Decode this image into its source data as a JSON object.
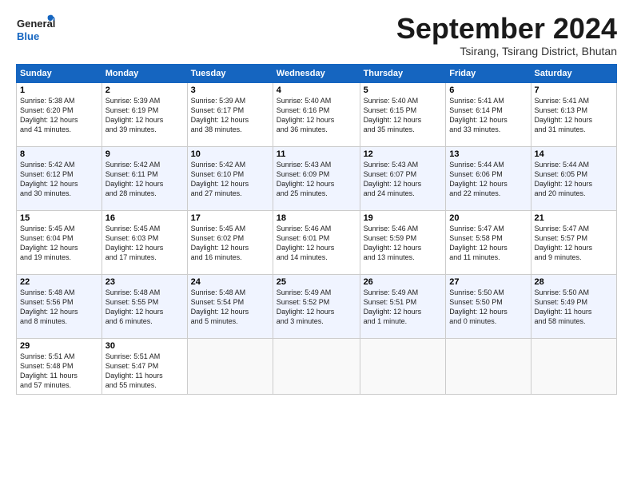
{
  "header": {
    "logo_general": "General",
    "logo_blue": "Blue",
    "month": "September 2024",
    "location": "Tsirang, Tsirang District, Bhutan"
  },
  "days_of_week": [
    "Sunday",
    "Monday",
    "Tuesday",
    "Wednesday",
    "Thursday",
    "Friday",
    "Saturday"
  ],
  "weeks": [
    [
      {
        "day": "1",
        "lines": [
          "Sunrise: 5:38 AM",
          "Sunset: 6:20 PM",
          "Daylight: 12 hours",
          "and 41 minutes."
        ]
      },
      {
        "day": "2",
        "lines": [
          "Sunrise: 5:39 AM",
          "Sunset: 6:19 PM",
          "Daylight: 12 hours",
          "and 39 minutes."
        ]
      },
      {
        "day": "3",
        "lines": [
          "Sunrise: 5:39 AM",
          "Sunset: 6:17 PM",
          "Daylight: 12 hours",
          "and 38 minutes."
        ]
      },
      {
        "day": "4",
        "lines": [
          "Sunrise: 5:40 AM",
          "Sunset: 6:16 PM",
          "Daylight: 12 hours",
          "and 36 minutes."
        ]
      },
      {
        "day": "5",
        "lines": [
          "Sunrise: 5:40 AM",
          "Sunset: 6:15 PM",
          "Daylight: 12 hours",
          "and 35 minutes."
        ]
      },
      {
        "day": "6",
        "lines": [
          "Sunrise: 5:41 AM",
          "Sunset: 6:14 PM",
          "Daylight: 12 hours",
          "and 33 minutes."
        ]
      },
      {
        "day": "7",
        "lines": [
          "Sunrise: 5:41 AM",
          "Sunset: 6:13 PM",
          "Daylight: 12 hours",
          "and 31 minutes."
        ]
      }
    ],
    [
      {
        "day": "8",
        "lines": [
          "Sunrise: 5:42 AM",
          "Sunset: 6:12 PM",
          "Daylight: 12 hours",
          "and 30 minutes."
        ]
      },
      {
        "day": "9",
        "lines": [
          "Sunrise: 5:42 AM",
          "Sunset: 6:11 PM",
          "Daylight: 12 hours",
          "and 28 minutes."
        ]
      },
      {
        "day": "10",
        "lines": [
          "Sunrise: 5:42 AM",
          "Sunset: 6:10 PM",
          "Daylight: 12 hours",
          "and 27 minutes."
        ]
      },
      {
        "day": "11",
        "lines": [
          "Sunrise: 5:43 AM",
          "Sunset: 6:09 PM",
          "Daylight: 12 hours",
          "and 25 minutes."
        ]
      },
      {
        "day": "12",
        "lines": [
          "Sunrise: 5:43 AM",
          "Sunset: 6:07 PM",
          "Daylight: 12 hours",
          "and 24 minutes."
        ]
      },
      {
        "day": "13",
        "lines": [
          "Sunrise: 5:44 AM",
          "Sunset: 6:06 PM",
          "Daylight: 12 hours",
          "and 22 minutes."
        ]
      },
      {
        "day": "14",
        "lines": [
          "Sunrise: 5:44 AM",
          "Sunset: 6:05 PM",
          "Daylight: 12 hours",
          "and 20 minutes."
        ]
      }
    ],
    [
      {
        "day": "15",
        "lines": [
          "Sunrise: 5:45 AM",
          "Sunset: 6:04 PM",
          "Daylight: 12 hours",
          "and 19 minutes."
        ]
      },
      {
        "day": "16",
        "lines": [
          "Sunrise: 5:45 AM",
          "Sunset: 6:03 PM",
          "Daylight: 12 hours",
          "and 17 minutes."
        ]
      },
      {
        "day": "17",
        "lines": [
          "Sunrise: 5:45 AM",
          "Sunset: 6:02 PM",
          "Daylight: 12 hours",
          "and 16 minutes."
        ]
      },
      {
        "day": "18",
        "lines": [
          "Sunrise: 5:46 AM",
          "Sunset: 6:01 PM",
          "Daylight: 12 hours",
          "and 14 minutes."
        ]
      },
      {
        "day": "19",
        "lines": [
          "Sunrise: 5:46 AM",
          "Sunset: 5:59 PM",
          "Daylight: 12 hours",
          "and 13 minutes."
        ]
      },
      {
        "day": "20",
        "lines": [
          "Sunrise: 5:47 AM",
          "Sunset: 5:58 PM",
          "Daylight: 12 hours",
          "and 11 minutes."
        ]
      },
      {
        "day": "21",
        "lines": [
          "Sunrise: 5:47 AM",
          "Sunset: 5:57 PM",
          "Daylight: 12 hours",
          "and 9 minutes."
        ]
      }
    ],
    [
      {
        "day": "22",
        "lines": [
          "Sunrise: 5:48 AM",
          "Sunset: 5:56 PM",
          "Daylight: 12 hours",
          "and 8 minutes."
        ]
      },
      {
        "day": "23",
        "lines": [
          "Sunrise: 5:48 AM",
          "Sunset: 5:55 PM",
          "Daylight: 12 hours",
          "and 6 minutes."
        ]
      },
      {
        "day": "24",
        "lines": [
          "Sunrise: 5:48 AM",
          "Sunset: 5:54 PM",
          "Daylight: 12 hours",
          "and 5 minutes."
        ]
      },
      {
        "day": "25",
        "lines": [
          "Sunrise: 5:49 AM",
          "Sunset: 5:52 PM",
          "Daylight: 12 hours",
          "and 3 minutes."
        ]
      },
      {
        "day": "26",
        "lines": [
          "Sunrise: 5:49 AM",
          "Sunset: 5:51 PM",
          "Daylight: 12 hours",
          "and 1 minute."
        ]
      },
      {
        "day": "27",
        "lines": [
          "Sunrise: 5:50 AM",
          "Sunset: 5:50 PM",
          "Daylight: 12 hours",
          "and 0 minutes."
        ]
      },
      {
        "day": "28",
        "lines": [
          "Sunrise: 5:50 AM",
          "Sunset: 5:49 PM",
          "Daylight: 11 hours",
          "and 58 minutes."
        ]
      }
    ],
    [
      {
        "day": "29",
        "lines": [
          "Sunrise: 5:51 AM",
          "Sunset: 5:48 PM",
          "Daylight: 11 hours",
          "and 57 minutes."
        ]
      },
      {
        "day": "30",
        "lines": [
          "Sunrise: 5:51 AM",
          "Sunset: 5:47 PM",
          "Daylight: 11 hours",
          "and 55 minutes."
        ]
      },
      null,
      null,
      null,
      null,
      null
    ]
  ]
}
